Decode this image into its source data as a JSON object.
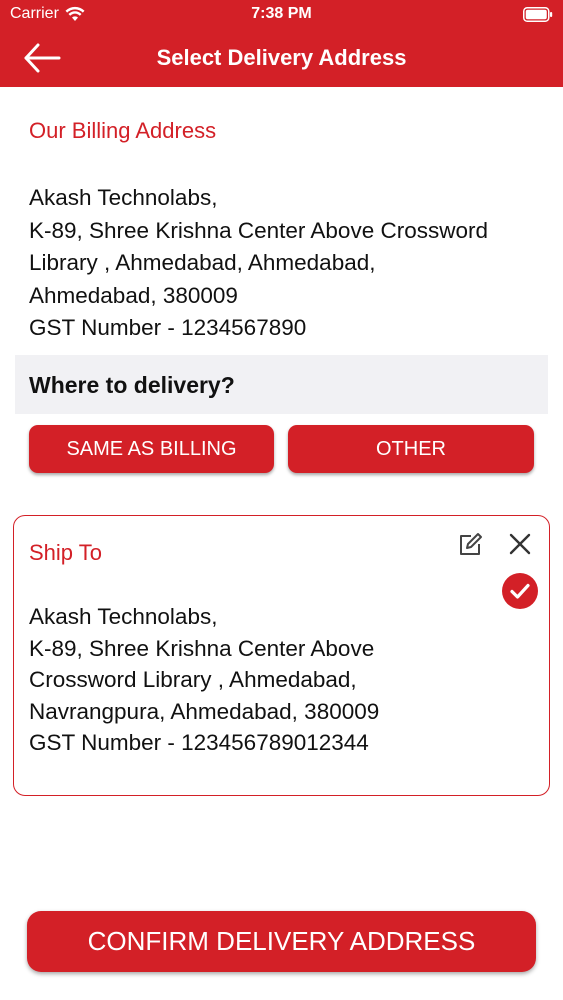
{
  "status_bar": {
    "carrier": "Carrier",
    "time": "7:38 PM",
    "icons": [
      "wifi-icon",
      "battery-icon"
    ]
  },
  "nav": {
    "title": "Select Delivery Address",
    "back_icon": "arrow-left-icon"
  },
  "billing": {
    "heading": "Our Billing Address",
    "lines": [
      "Akash Technolabs,",
      "K-89, Shree Krishna Center Above Crossword",
      "Library , Ahmedabad, Ahmedabad,",
      "Ahmedabad, 380009",
      "GST Number - 1234567890"
    ]
  },
  "delivery": {
    "question": "Where to delivery?",
    "same_label": "SAME AS BILLING",
    "other_label": "OTHER"
  },
  "ship_to": {
    "heading": "Ship To",
    "lines": [
      "Akash Technolabs,",
      "K-89, Shree Krishna Center Above",
      "Crossword Library , Ahmedabad,",
      "Navrangpura, Ahmedabad, 380009",
      "GST Number - 123456789012344"
    ],
    "icons": [
      "edit-icon",
      "close-icon",
      "check-circle-icon"
    ],
    "selected": true
  },
  "confirm_label": "CONFIRM DELIVERY ADDRESS",
  "colors": {
    "accent": "#d32027",
    "band": "#f1f1f4",
    "text": "#111111"
  }
}
